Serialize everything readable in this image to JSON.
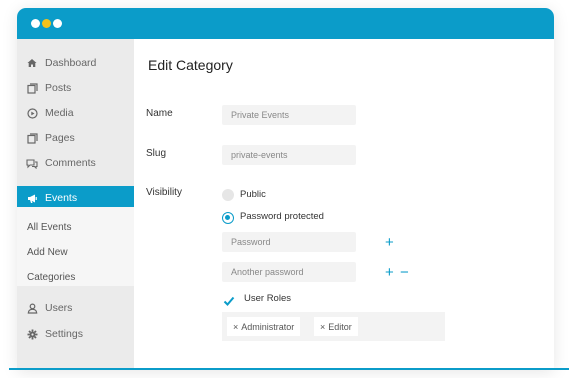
{
  "window": {
    "controls": [
      "close",
      "minimize",
      "maximize"
    ]
  },
  "sidebar": {
    "items": [
      {
        "label": "Dashboard",
        "icon": "dashboard-icon"
      },
      {
        "label": "Posts",
        "icon": "posts-icon"
      },
      {
        "label": "Media",
        "icon": "media-icon"
      },
      {
        "label": "Pages",
        "icon": "pages-icon"
      },
      {
        "label": "Comments",
        "icon": "comments-icon"
      },
      {
        "label": "Events",
        "icon": "megaphone-icon",
        "active": true
      },
      {
        "label": "Users",
        "icon": "user-icon"
      },
      {
        "label": "Settings",
        "icon": "gear-icon"
      }
    ],
    "submenu": [
      {
        "label": "All Events"
      },
      {
        "label": "Add New"
      },
      {
        "label": "Categories"
      }
    ]
  },
  "main": {
    "title": "Edit Category",
    "name_label": "Name",
    "name_value": "Private Events",
    "slug_label": "Slug",
    "slug_value": "private-events",
    "visibility_label": "Visibility",
    "radio_public": "Public",
    "radio_password": "Password protected",
    "selected_visibility": "Password protected",
    "password_placeholder": "Password",
    "another_password_placeholder": "Another password",
    "add_symbol": "+",
    "remove_symbol": "−",
    "user_roles_label": "User Roles",
    "user_roles_checked": true,
    "roles": [
      "Administrator",
      "Editor"
    ],
    "remove_tag_symbol": "×"
  },
  "colors": {
    "accent": "#0b9cc9",
    "dot_yellow": "#f4c21b"
  }
}
